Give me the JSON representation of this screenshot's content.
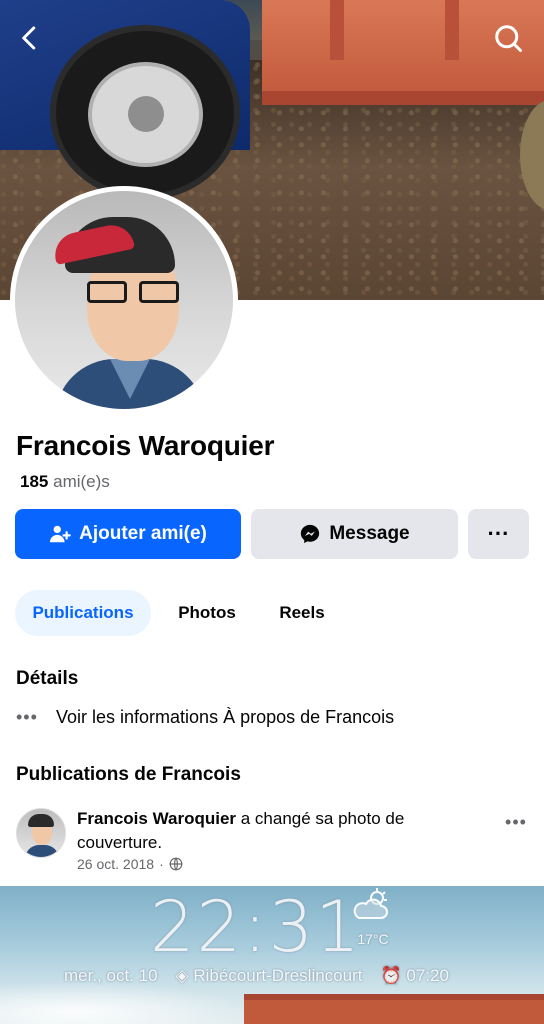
{
  "profile": {
    "name": "Francois Waroquier",
    "friends_count": "185",
    "friends_label": "ami(e)s"
  },
  "actions": {
    "add_friend": "Ajouter ami(e)",
    "message": "Message",
    "more": "···"
  },
  "tabs": [
    {
      "label": "Publications",
      "active": true
    },
    {
      "label": "Photos",
      "active": false
    },
    {
      "label": "Reels",
      "active": false
    }
  ],
  "details": {
    "title": "Détails",
    "about_link": "Voir les informations À propos de Francois",
    "dots": "•••"
  },
  "posts": {
    "title": "Publications de Francois",
    "items": [
      {
        "author": "Francois Waroquier",
        "action": "a changé sa photo de couverture.",
        "date": "26 oct. 2018",
        "separator": "·",
        "privacy_icon": "globe-icon",
        "more": "•••",
        "image": {
          "clock": "22:31",
          "temperature": "17°C",
          "day": "mer., oct. 10",
          "location": "Ribécourt-Dreslincourt",
          "alarm": "07:20"
        }
      }
    ]
  },
  "colors": {
    "accent": "#0866ff",
    "secondary_button": "#e4e6eb",
    "active_tab_bg": "#ebf5ff",
    "muted_text": "#65676b"
  },
  "icons": [
    "back-icon",
    "search-icon",
    "add-friend-icon",
    "messenger-icon",
    "more-icon",
    "globe-icon",
    "weather-icon",
    "alarm-icon",
    "location-icon"
  ]
}
